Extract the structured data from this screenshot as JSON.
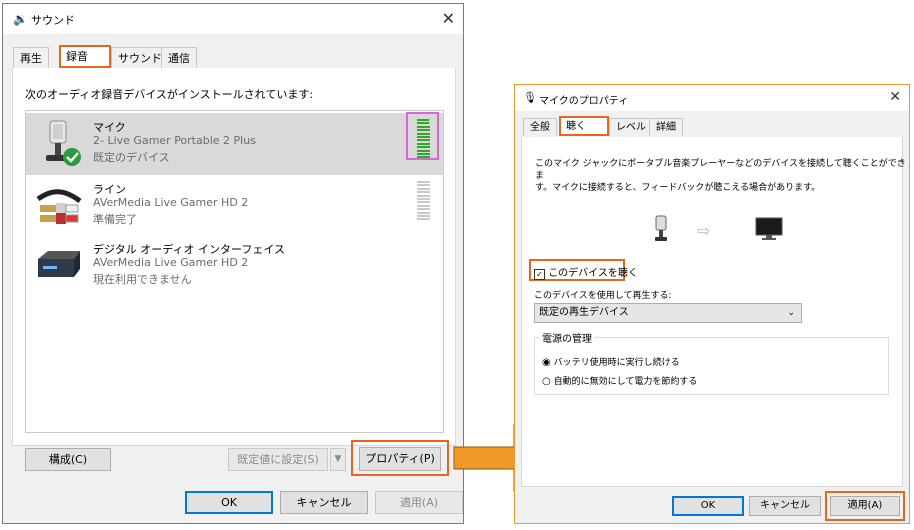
{
  "sound": {
    "title": "サウンド",
    "tabs": [
      "再生",
      "録音",
      "サウンド",
      "通信"
    ],
    "instruction": "次のオーディオ録音デバイスがインストールされています:",
    "devices": [
      {
        "name": "マイク",
        "desc": "2- Live Gamer Portable 2 Plus",
        "status": "既定のデバイス"
      },
      {
        "name": "ライン",
        "desc": "AVerMedia Live Gamer HD 2",
        "status": "準備完了"
      },
      {
        "name": "デジタル オーディオ インターフェイス",
        "desc": "AVerMedia Live Gamer HD 2",
        "status": "現在利用できません"
      }
    ],
    "buttons": {
      "configure": "構成(C)",
      "set_default": "既定値に設定(S)",
      "properties": "プロパティ(P)",
      "ok": "OK",
      "cancel": "キャンセル",
      "apply": "適用(A)"
    }
  },
  "mic_props": {
    "title": "マイクのプロパティ",
    "tabs": [
      "全般",
      "聴く",
      "レベル",
      "詳細"
    ],
    "description_line1": "このマイク ジャックにポータブル音楽プレーヤーなどのデバイスを接続して聴くことができま",
    "description_line2": "す。マイクに接続すると、フィードバックが聴こえる場合があります。",
    "listen_checkbox": "このデバイスを聴く",
    "listen_checked": true,
    "playback_label": "このデバイスを使用して再生する:",
    "playback_value": "既定の再生デバイス",
    "power_group": "電源の管理",
    "radio1": "バッテリ使用時に実行し続ける",
    "radio2": "自動的に無効にして電力を節約する",
    "buttons": {
      "ok": "OK",
      "cancel": "キャンセル",
      "apply": "適用(A)"
    }
  },
  "colors": {
    "highlight_orange": "#e8661b",
    "arrow_orange": "#f19a2a",
    "meter_highlight": "#d966d6",
    "level_green": "#36a52d"
  }
}
